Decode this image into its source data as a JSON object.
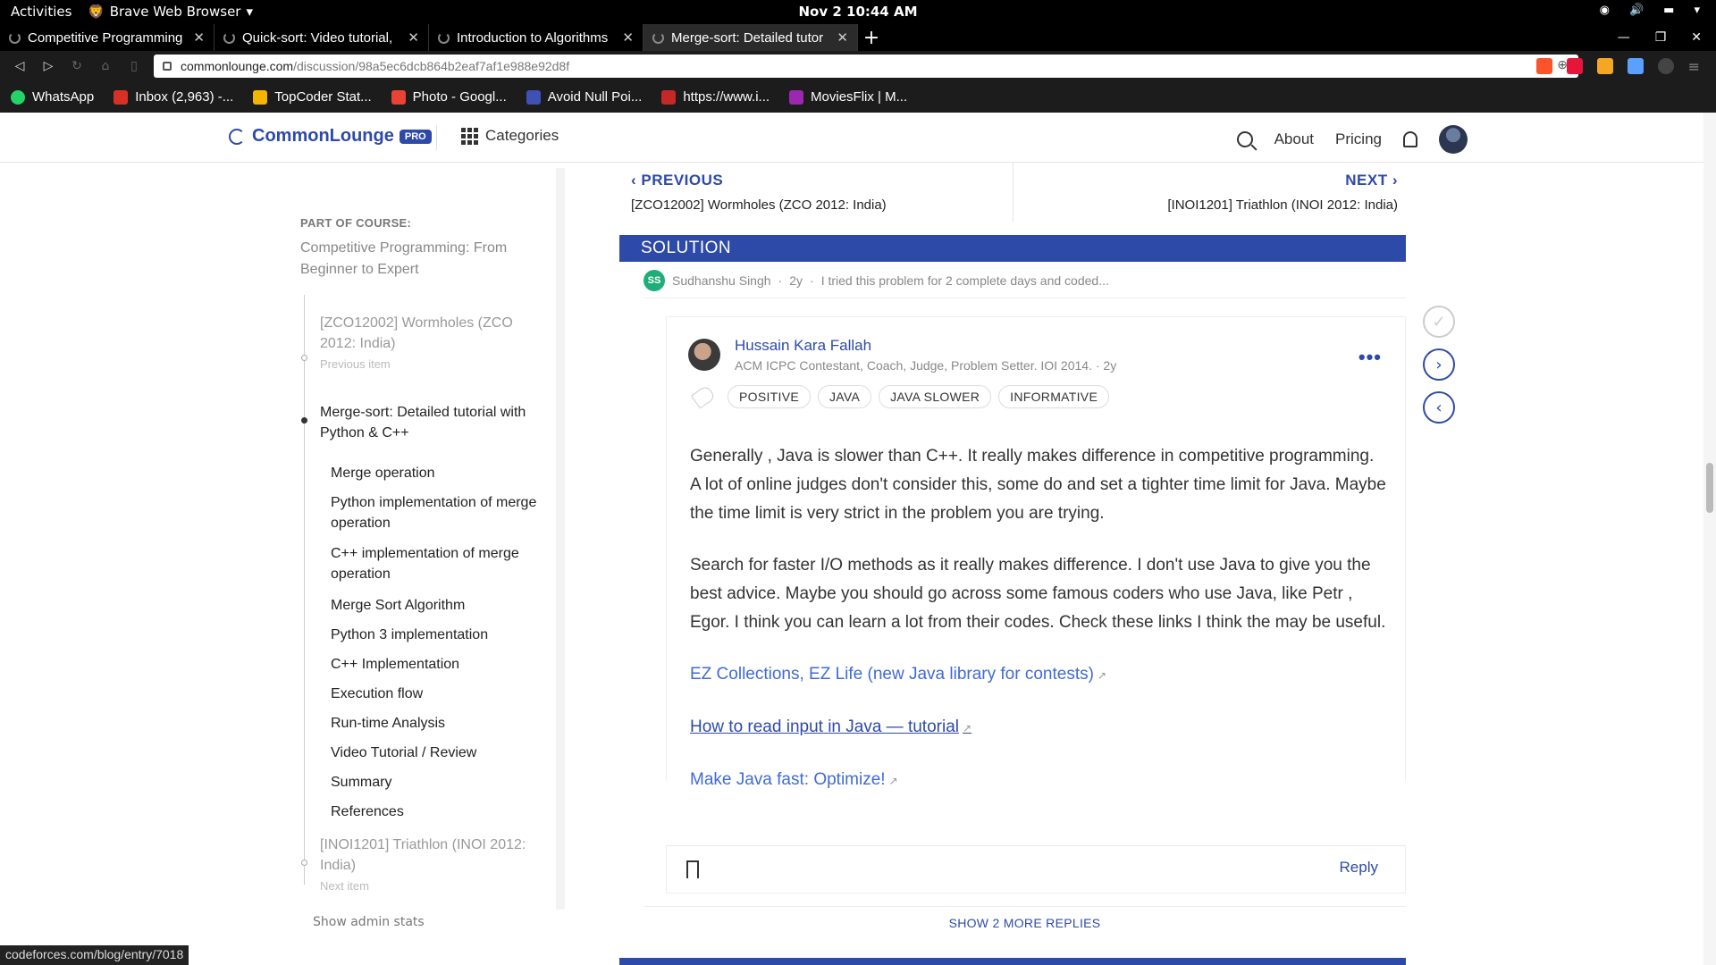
{
  "system": {
    "activities": "Activities",
    "app_name": "Brave Web Browser",
    "clock": "Nov 2  10:44 AM"
  },
  "tabs": [
    {
      "title": "Competitive Programming",
      "active": false
    },
    {
      "title": "Quick-sort: Video tutorial,",
      "active": false
    },
    {
      "title": "Introduction to Algorithms",
      "active": false
    },
    {
      "title": "Merge-sort: Detailed tutor",
      "active": true
    }
  ],
  "address": {
    "host": "commonlounge.com",
    "path": "/discussion/98a5ec6dcb864b2eaf7af1e988e92d8f"
  },
  "bookmarks": [
    {
      "label": "WhatsApp",
      "color": "#25d366"
    },
    {
      "label": "Inbox (2,963) -...",
      "color": "#d93025"
    },
    {
      "label": "TopCoder Stat...",
      "color": "#f5b400"
    },
    {
      "label": "Photo - Googl...",
      "color": "#ea4335"
    },
    {
      "label": "Avoid Null Poi...",
      "color": "#3f51b5"
    },
    {
      "label": "https://www.i...",
      "color": "#c62828"
    },
    {
      "label": "MoviesFlix | M...",
      "color": "#9c27b0"
    }
  ],
  "header": {
    "logo": "CommonLounge",
    "pro_badge": "PRO",
    "categories": "Categories",
    "about": "About",
    "pricing": "Pricing"
  },
  "sidebar": {
    "part_label": "PART OF COURSE:",
    "course_title": "Competitive Programming: From Beginner to Expert",
    "previous_item": {
      "title": "[ZCO12002] Wormholes (ZCO 2012: India)",
      "sub": "Previous item"
    },
    "current_item": "Merge-sort: Detailed tutorial with Python & C++",
    "subitems": [
      "Merge operation",
      "Python implementation of merge operation",
      "C++ implementation of merge operation",
      "Merge Sort Algorithm",
      "Python 3 implementation",
      "C++ Implementation",
      "Execution flow",
      "Run-time Analysis",
      "Video Tutorial / Review",
      "Summary",
      "References"
    ],
    "next_item": {
      "title": "[INOI1201] Triathlon (INOI 2012: India)",
      "sub": "Next item"
    },
    "admin": "Show admin stats"
  },
  "pager": {
    "prev_label": "PREVIOUS",
    "prev_title": "[ZCO12002] Wormholes (ZCO 2012: India)",
    "next_label": "NEXT",
    "next_title": "[INOI1201] Triathlon (INOI 2012: India)"
  },
  "solution": {
    "heading": "SOLUTION",
    "answer_author_initials": "SS",
    "answer_author": "Sudhanshu Singh",
    "answer_age": "2y",
    "answer_snippet": "I tried this problem for 2 complete days and coded..."
  },
  "comment": {
    "author": "Hussain Kara Fallah",
    "meta": "ACM ICPC Contestant, Coach, Judge, Problem Setter. IOI 2014. · 2y",
    "tags": [
      "POSITIVE",
      "JAVA",
      "JAVA SLOWER",
      "INFORMATIVE"
    ],
    "para1": "Generally , Java is slower than C++. It really makes difference in competitive programming. A lot of online judges don't consider this, some do and set a tighter time limit for Java. Maybe the time limit is very strict in the problem you are trying.",
    "para2": "Search for faster I/O methods as it really makes difference. I don't use Java to give you the best advice. Maybe you should go across some famous coders who use Java, like Petr , Egor. I think you can learn a lot from their codes. Check these links I think the may be useful.",
    "links": [
      "EZ Collections, EZ Life (new Java library for contests)",
      "How to read input in Java — tutorial",
      "Make Java fast: Optimize!"
    ],
    "reply": "Reply"
  },
  "show_more": "SHOW 2 MORE REPLIES",
  "status_url": "codeforces.com/blog/entry/7018",
  "colors": {
    "accent": "#2e4aa8",
    "link": "#3f6ad8"
  }
}
